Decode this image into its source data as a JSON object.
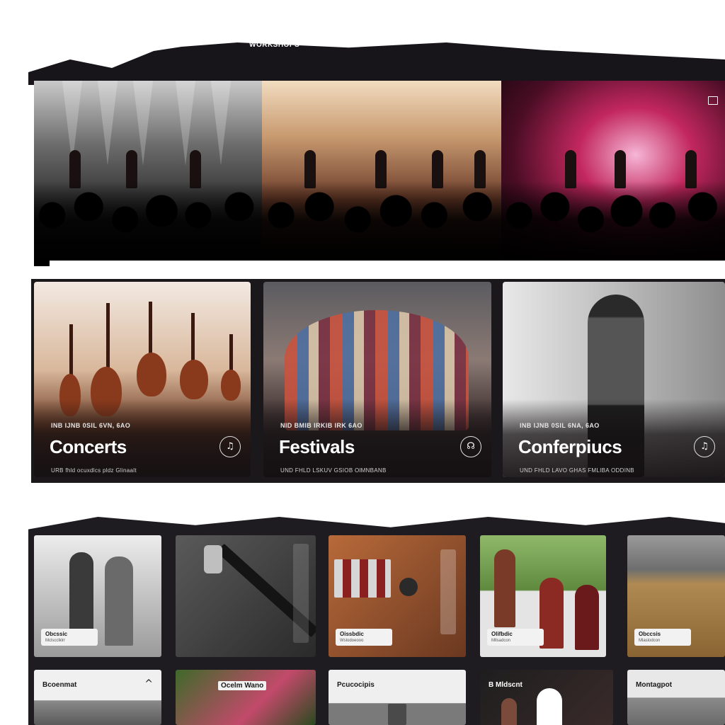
{
  "nav": {
    "items": [
      "",
      "WORKSHOPS",
      ""
    ]
  },
  "hero": {
    "panels": [
      {
        "name": "concert-photo-monochrome"
      },
      {
        "name": "concert-photo-warm"
      },
      {
        "name": "concert-photo-magenta"
      }
    ],
    "corner_icon": "window-icon"
  },
  "categories": [
    {
      "eyebrow": "INB IJNB 0SIL 6VN, 6AO",
      "title": "Concerts",
      "subtitle": "URB fhld ocuxdlcs pldz Glinaalt",
      "action_icon": "music-icon",
      "action_glyph": "♫"
    },
    {
      "eyebrow": "NID BMIB IRKIB IRK 6AO",
      "title": "Festivals",
      "subtitle": "UND FHLD LSKUV GSIOB OlMNBANB",
      "action_icon": "headphones-icon",
      "action_glyph": "☊"
    },
    {
      "eyebrow": "INB IJNB 0SIL 6NA, 6AO",
      "title": "Conferpiucs",
      "subtitle": "UND FHLD LAVO GHAS FMLIBA ODDINB",
      "action_icon": "music-icon",
      "action_glyph": "♫"
    }
  ],
  "tiles_row1": [
    {
      "label": "Obcssic",
      "sub": "Mclscclklrr"
    },
    {
      "label": "",
      "sub": ""
    },
    {
      "label": "Oissbdic",
      "sub": "Wslodoeooo"
    },
    {
      "label": "Olifbdic",
      "sub": "Mllsadcon"
    },
    {
      "label": "Obccsis",
      "sub": "Mlaslodcon"
    }
  ],
  "tiles_row2": [
    {
      "head": "Bcoenmat"
    },
    {
      "head": "Ocelm Wano"
    },
    {
      "head": "Pcucocipis"
    },
    {
      "head": "B Mldscnt"
    },
    {
      "head": "Montagpot"
    }
  ],
  "close_glyph": "×",
  "colors": {
    "background": "#1b181c",
    "accent_magenta": "#c2275e",
    "accent_warm": "#c89a70"
  }
}
